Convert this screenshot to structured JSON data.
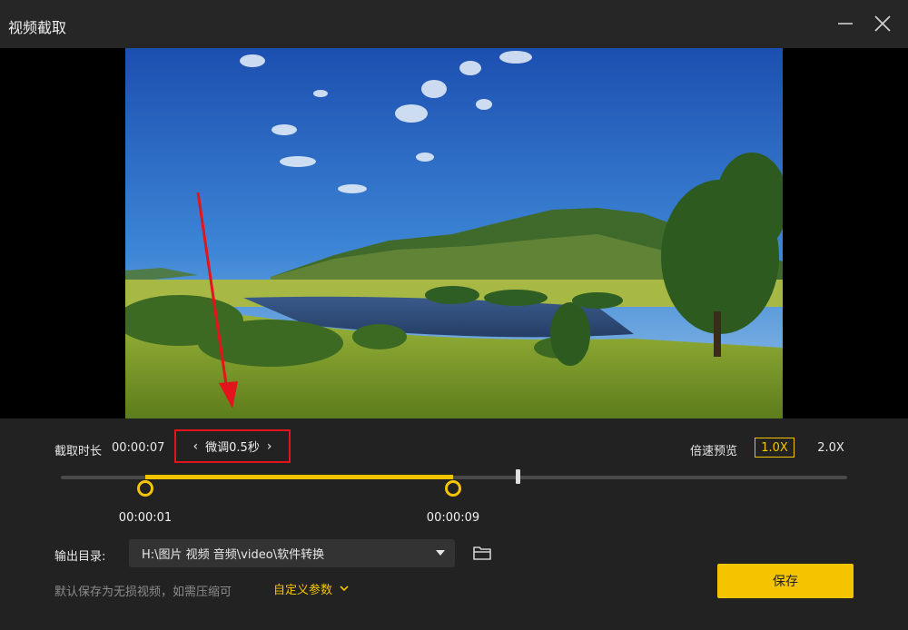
{
  "window": {
    "title": "视频截取"
  },
  "icons": {
    "minimize": "minimize-icon",
    "close": "close-icon",
    "folder": "folder-icon",
    "chevron_down": "chevron-down-icon",
    "chevron_left": "chevron-left-icon",
    "chevron_right": "chevron-right-icon"
  },
  "clip": {
    "duration_label": "截取时长",
    "duration_value": "00:00:07",
    "fine_tune_label": "微调0.5秒",
    "start_time": "00:00:01",
    "end_time": "00:00:09"
  },
  "speed_preview": {
    "label": "倍速预览",
    "options": [
      "1.0X",
      "2.0X"
    ],
    "selected": "1.0X"
  },
  "output": {
    "label": "输出目录:",
    "path": "H:\\图片 视频 音频\\video\\软件转换"
  },
  "note": "默认保存为无损视频，如需压缩可",
  "custom_params_label": "自定义参数",
  "save_label": "保存",
  "colors": {
    "accent": "#f5c400",
    "highlight_box": "#e3141b",
    "arrow": "#e3141b",
    "background": "#1f1f1f"
  }
}
